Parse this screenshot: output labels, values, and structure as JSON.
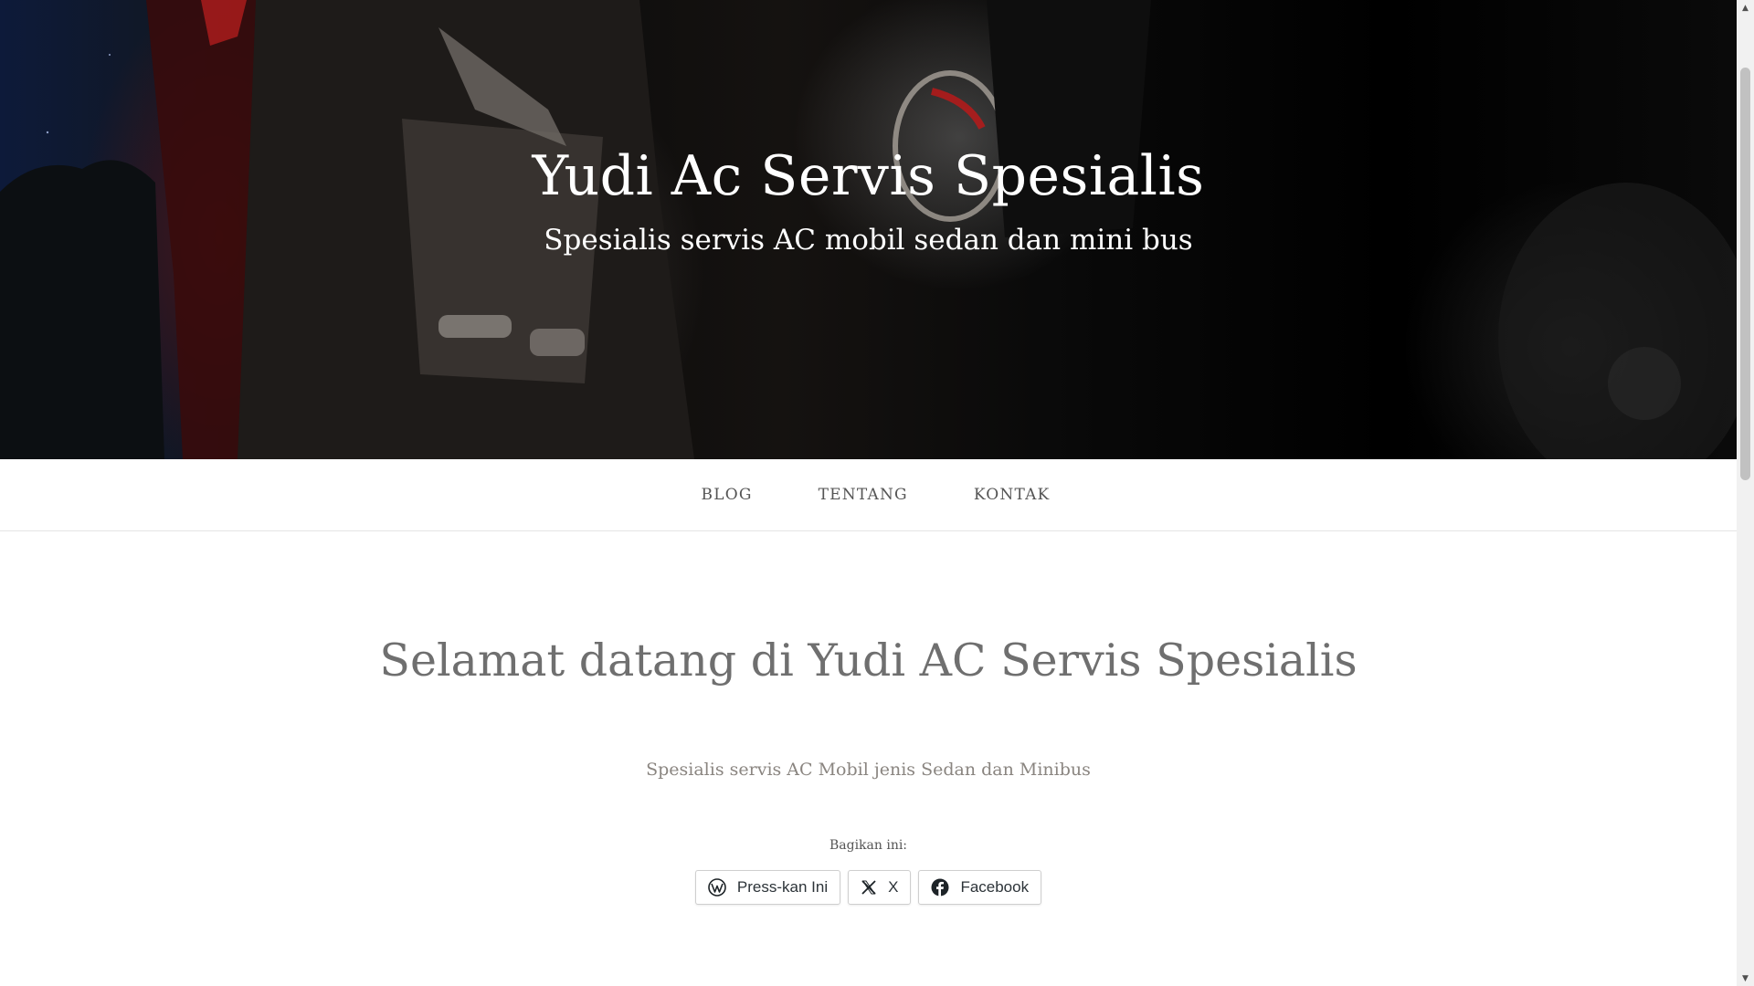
{
  "header": {
    "site_title": "Yudi Ac Servis Spesialis",
    "tagline": "Spesialis servis AC mobil sedan dan mini bus"
  },
  "nav": {
    "items": [
      {
        "label": "BLOG"
      },
      {
        "label": "TENTANG"
      },
      {
        "label": "KONTAK"
      }
    ]
  },
  "content": {
    "title": "Selamat datang di Yudi AC Servis Spesialis",
    "lead": "Spesialis servis AC Mobil jenis Sedan dan Minibus"
  },
  "share": {
    "heading": "Bagikan ini:",
    "buttons": [
      {
        "label": "Press-kan Ini",
        "icon": "wordpress-icon"
      },
      {
        "label": "X",
        "icon": "x-icon"
      },
      {
        "label": "Facebook",
        "icon": "facebook-icon"
      }
    ]
  },
  "scrollbar": {
    "up_arrow": "▲",
    "down_arrow": "▼"
  }
}
